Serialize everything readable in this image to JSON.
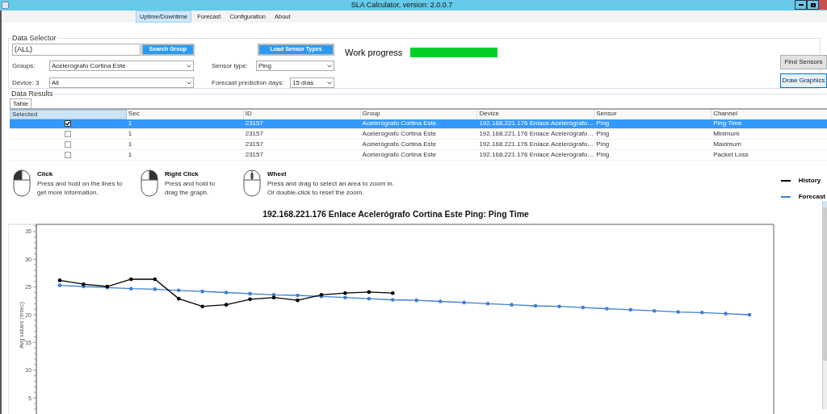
{
  "window": {
    "title": "SLA Calculator, version: 2.0.0.7"
  },
  "menu": [
    {
      "label": "Uptime/Downtime",
      "selected": true
    },
    {
      "label": "Forecast",
      "selected": false
    },
    {
      "label": "Configuration",
      "selected": false
    },
    {
      "label": "About",
      "selected": false
    }
  ],
  "data_selector": {
    "title": "Data Selector",
    "search": {
      "value": "(ALL)"
    },
    "search_button": "Search Group",
    "load_button": "Load Sensor Types",
    "work_progress": {
      "label": "Work progress",
      "level": 1
    },
    "groups": {
      "label": "Groups:",
      "value": "Acelerógrafo Cortina Este"
    },
    "device": {
      "label": "Device: 3",
      "value": "All"
    },
    "sensor_type": {
      "label": "Sensor type:",
      "value": "Ping"
    },
    "forecast_days": {
      "label": "Forecast prediction days:",
      "value": "15 días"
    },
    "find_button": "Find Sensors",
    "draw_button": "Draw Graphics"
  },
  "data_results": {
    "title": "Data Results",
    "tabs": [
      {
        "label": "Table",
        "selected": true
      }
    ],
    "table": {
      "columns": [
        "Selected",
        "Sec",
        "ID",
        "Group",
        "Device",
        "Sensor",
        "Channel"
      ],
      "rows": [
        {
          "selected": true,
          "checked": true,
          "cells": [
            "",
            "1",
            "23157",
            "Acelerógrafo Cortina Este",
            "192.168.221.176 Enlace Acelerógrafo…",
            "Ping",
            "Ping Time"
          ]
        },
        {
          "selected": false,
          "checked": false,
          "cells": [
            "",
            "1",
            "23157",
            "Acelerógrafo Cortina Este",
            "192.168.221.176 Enlace Acelerógrafo…",
            "Ping",
            "Minimum"
          ]
        },
        {
          "selected": false,
          "checked": false,
          "cells": [
            "",
            "1",
            "23157",
            "Acelerógrafo Cortina Este",
            "192.168.221.176 Enlace Acelerógrafo…",
            "Ping",
            "Maximum"
          ]
        },
        {
          "selected": false,
          "checked": false,
          "cells": [
            "",
            "1",
            "23157",
            "Acelerógrafo Cortina Este",
            "192.168.221.176 Enlace Acelerógrafo…",
            "Ping",
            "Packet Loss"
          ]
        }
      ]
    }
  },
  "hints": [
    {
      "kind": "left",
      "title": "Click",
      "lines": [
        "Press and hold on the lines to",
        "get more information."
      ]
    },
    {
      "kind": "right",
      "title": "Right Click",
      "lines": [
        "Press and hold to",
        "drag the graph."
      ]
    },
    {
      "kind": "wheel",
      "title": "Wheel",
      "lines": [
        "Press and drag to select an area to zoom in.",
        "Or double-click to reset the zoom."
      ]
    }
  ],
  "chart": {
    "chart_data": {
      "type": "line",
      "title": "192.168.221.176 Enlace Acelerógrafo Cortina Este Ping: Ping Time",
      "ylabel": "Avg values (msec)",
      "ylim": [
        2,
        36.3
      ],
      "yticks": [
        5,
        10,
        15,
        20,
        25,
        30,
        35
      ],
      "series": [
        {
          "name": "History",
          "color": "#000000",
          "values": [
            26.2,
            25.5,
            25.1,
            26.4,
            26.4,
            22.9,
            21.5,
            21.8,
            22.8,
            23.1,
            22.6,
            23.6,
            23.9,
            24.1,
            23.9,
            null,
            null,
            null,
            null,
            null,
            null,
            null,
            null,
            null,
            null,
            null,
            null,
            null,
            null,
            null
          ]
        },
        {
          "name": "Forecast",
          "color": "#3f7fd0",
          "values": [
            25.3,
            25.1,
            24.9,
            24.7,
            24.6,
            24.4,
            24.2,
            24.0,
            23.8,
            23.6,
            23.5,
            23.3,
            23.1,
            22.9,
            22.7,
            22.6,
            22.4,
            22.2,
            22.0,
            21.8,
            21.6,
            21.5,
            21.3,
            21.1,
            20.9,
            20.7,
            20.5,
            20.4,
            20.2,
            20.0
          ]
        }
      ]
    }
  }
}
